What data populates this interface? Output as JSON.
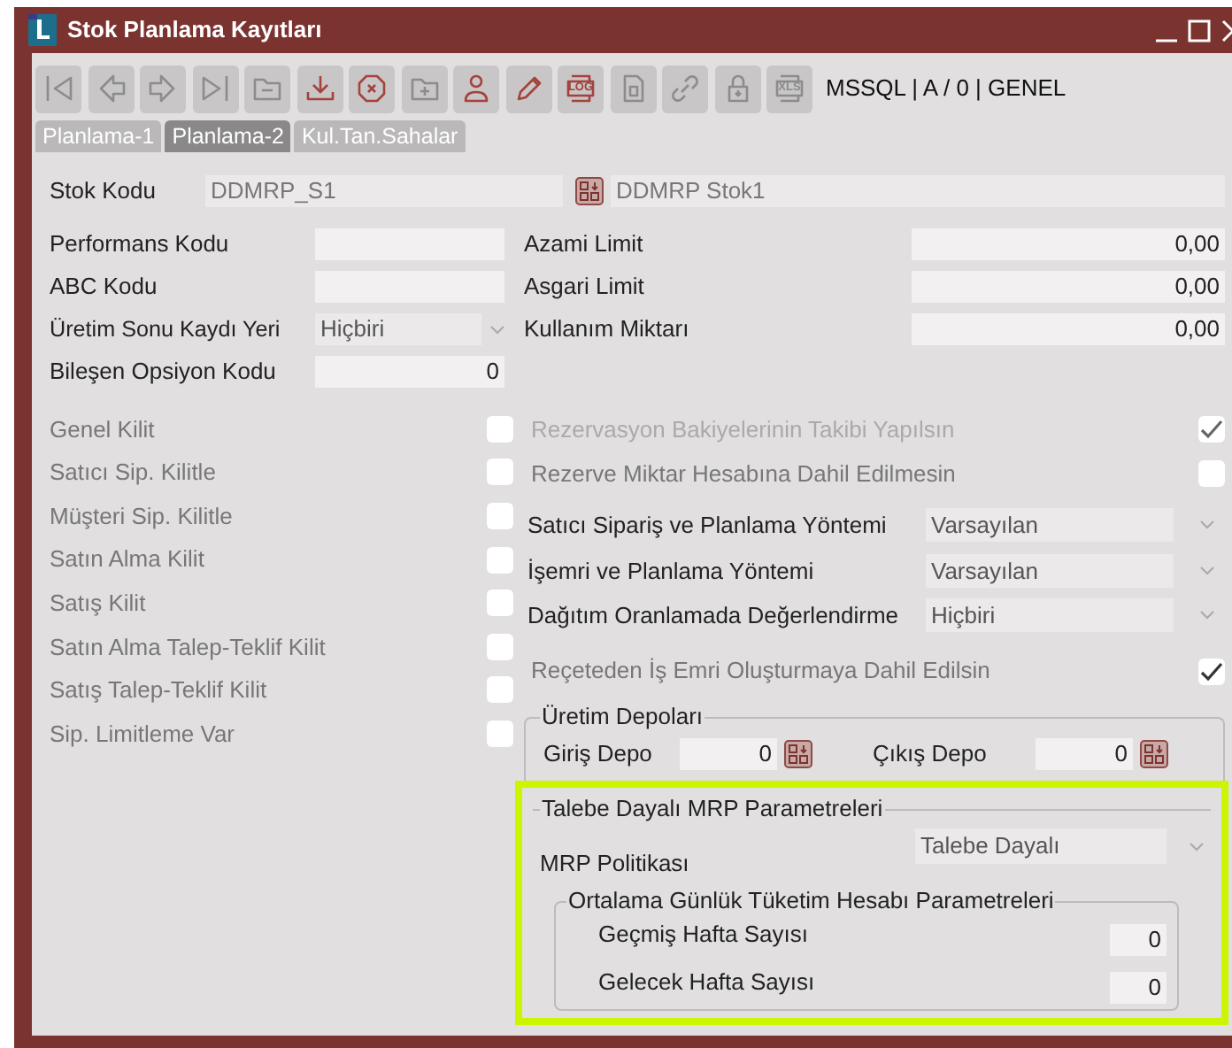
{
  "window": {
    "title": "Stok Planlama Kayıtları"
  },
  "toolbar": {
    "buttons": [
      {
        "kind": "first"
      },
      {
        "kind": "prev"
      },
      {
        "kind": "next"
      },
      {
        "kind": "last"
      },
      {
        "kind": "folder-minus"
      },
      {
        "kind": "download"
      },
      {
        "kind": "cancel"
      },
      {
        "kind": "folder-plus"
      },
      {
        "kind": "user"
      },
      {
        "kind": "edit"
      },
      {
        "kind": "log",
        "label": "LOG"
      },
      {
        "kind": "document"
      },
      {
        "kind": "link"
      },
      {
        "kind": "lock"
      },
      {
        "kind": "xls",
        "label": "XLS"
      }
    ],
    "connection": "MSSQL | A / 0 | GENEL"
  },
  "tabs": [
    {
      "label": "Planlama-1",
      "selected": false
    },
    {
      "label": "Planlama-2",
      "selected": true
    },
    {
      "label": "Kul.Tan.Sahalar",
      "selected": false
    }
  ],
  "stock": {
    "label": "Stok Kodu",
    "code": "DDMRP_S1",
    "name": "DDMRP Stok1"
  },
  "left_fields": [
    {
      "kind": "text",
      "label": "Performans Kodu"
    },
    {
      "kind": "text",
      "label": "ABC Kodu"
    },
    {
      "kind": "select",
      "label": "Üretim Sonu Kaydı Yeri",
      "value": "Hiçbiri"
    },
    {
      "kind": "number",
      "label": "Bileşen Opsiyon Kodu",
      "value": "0"
    }
  ],
  "left_checks": [
    {
      "label": "Genel Kilit",
      "checked": false,
      "disabled": false
    },
    {
      "label": "Satıcı Sip. Kilitle",
      "checked": false,
      "disabled": false
    },
    {
      "label": "Müşteri Sip. Kilitle",
      "checked": false,
      "disabled": false
    },
    {
      "label": "Satın Alma Kilit",
      "checked": false,
      "disabled": false
    },
    {
      "label": "Satış Kilit",
      "checked": false,
      "disabled": false
    },
    {
      "label": "Satın Alma Talep-Teklif Kilit",
      "checked": false,
      "disabled": false
    },
    {
      "label": "Satış Talep-Teklif Kilit",
      "checked": false,
      "disabled": false
    },
    {
      "label": "Sip. Limitleme Var",
      "checked": false,
      "disabled": false
    }
  ],
  "right_fields": [
    {
      "label": "Azami Limit",
      "value": "0,00"
    },
    {
      "label": "Asgari Limit",
      "value": "0,00"
    },
    {
      "label": "Kullanım Miktarı",
      "value": "0,00"
    }
  ],
  "right_items": [
    {
      "kind": "check",
      "label": "Rezervasyon Bakiyelerinin Takibi Yapılsın",
      "checked": true,
      "disabled": true
    },
    {
      "kind": "check",
      "label": "Rezerve Miktar Hesabına Dahil Edilmesin",
      "checked": false,
      "disabled": false
    },
    {
      "kind": "select",
      "label": "Satıcı Sipariş ve Planlama Yöntemi",
      "value": "Varsayılan"
    },
    {
      "kind": "select",
      "label": "İşemri ve Planlama Yöntemi",
      "value": "Varsayılan"
    },
    {
      "kind": "select",
      "label": "Dağıtım Oranlamada Değerlendirme",
      "value": "Hiçbiri"
    },
    {
      "kind": "check",
      "label": "Reçeteden İş Emri Oluşturmaya Dahil Edilsin",
      "checked": true,
      "disabled": false
    }
  ],
  "production_depots": {
    "title": "Üretim Depoları",
    "fields": [
      {
        "label": "Giriş Depo",
        "value": "0"
      },
      {
        "label": "Çıkış Depo",
        "value": "0"
      }
    ]
  },
  "ddmrp": {
    "title": "Talebe Dayalı MRP Parametreleri",
    "highlighted": true,
    "policy": {
      "label": "MRP Politikası",
      "value": "Talebe Dayalı"
    },
    "consumption": {
      "title": "Ortalama Günlük Tüketim Hesabı Parametreleri",
      "fields": [
        {
          "label": "Geçmiş Hafta Sayısı",
          "value": "0"
        },
        {
          "label": "Gelecek Hafta Sayısı",
          "value": "0"
        }
      ]
    }
  }
}
